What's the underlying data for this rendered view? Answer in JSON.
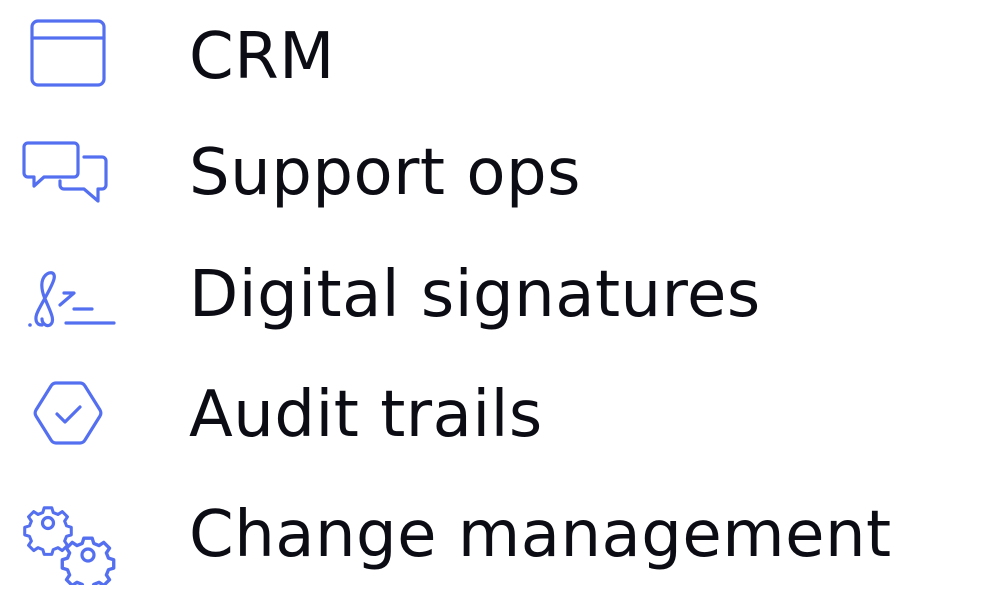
{
  "colors": {
    "accent": "#5470f0",
    "text": "#0c0c14",
    "background": "#ffffff"
  },
  "items": [
    {
      "label": "CRM",
      "icon": "browser-window-icon"
    },
    {
      "label": "Support ops",
      "icon": "chat-bubbles-icon"
    },
    {
      "label": "Digital signatures",
      "icon": "signature-icon"
    },
    {
      "label": "Audit trails",
      "icon": "check-badge-icon"
    },
    {
      "label": "Change management",
      "icon": "gears-icon"
    }
  ]
}
